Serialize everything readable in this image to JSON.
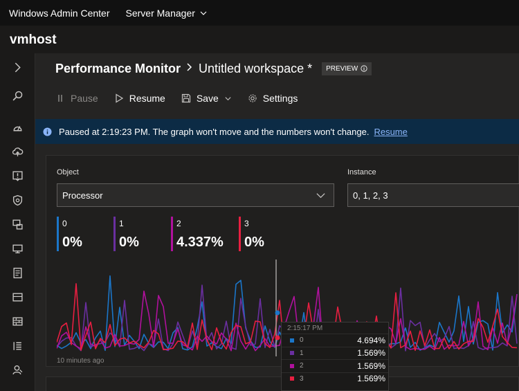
{
  "topbar": {
    "app_name": "Windows Admin Center",
    "server_manager": "Server Manager"
  },
  "host": {
    "name": "vmhost"
  },
  "sidebar": {
    "icons": [
      "expand-chevron-icon",
      "search-icon",
      "overview-icon",
      "cloud-upload-icon",
      "alerts-icon",
      "security-shield-icon",
      "devices-icon",
      "computer-management-icon",
      "event-log-icon",
      "files-icon",
      "firewall-icon",
      "list-icon",
      "users-icon"
    ]
  },
  "header": {
    "title": "Performance Monitor",
    "workspace": "Untitled workspace *",
    "badge": "PREVIEW"
  },
  "toolbar": {
    "pause": "Pause",
    "resume": "Resume",
    "save": "Save",
    "settings": "Settings"
  },
  "infobar": {
    "message": "Paused at 2:19:23 PM. The graph won't move and the numbers won't change.",
    "link": "Resume"
  },
  "form": {
    "object_label": "Object",
    "object_value": "Processor",
    "instance_label": "Instance",
    "instance_value": "0, 1, 2, 3"
  },
  "counters": [
    {
      "name": "0",
      "value": "0%",
      "color": "#1b76c9"
    },
    {
      "name": "1",
      "value": "0%",
      "color": "#6a2fa0"
    },
    {
      "name": "2",
      "value": "4.337%",
      "color": "#b0119d"
    },
    {
      "name": "3",
      "value": "0%",
      "color": "#e81f41"
    }
  ],
  "chart": {
    "time_label": "10 minutes ago"
  },
  "tooltip": {
    "time": "2:15:17 PM",
    "rows": [
      {
        "name": "0",
        "value": "4.694%"
      },
      {
        "name": "1",
        "value": "1.569%"
      },
      {
        "name": "2",
        "value": "1.569%"
      },
      {
        "name": "3",
        "value": "1.569%"
      }
    ]
  }
}
